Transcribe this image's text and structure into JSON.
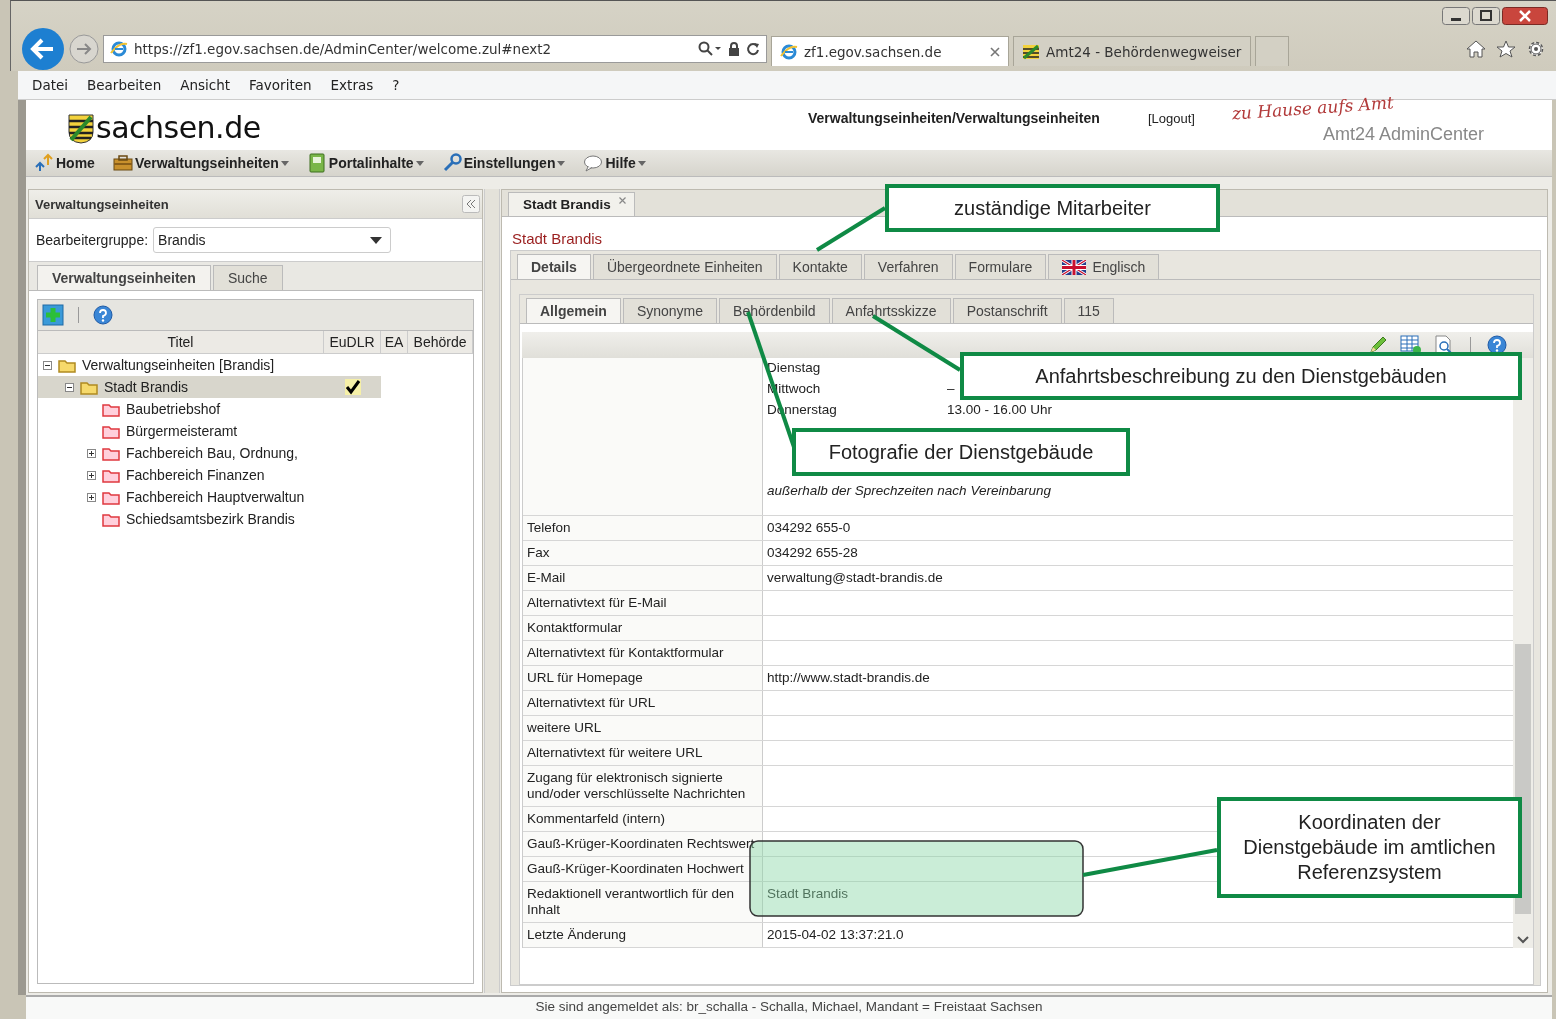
{
  "browser": {
    "url": "https://zf1.egov.sachsen.de/AdminCenter/welcome.zul#next2",
    "tabs": [
      {
        "title": "zf1.egov.sachsen.de",
        "selected": true
      },
      {
        "title": "Amt24 -  Behördenwegweiser",
        "selected": false
      }
    ]
  },
  "menu": [
    "Datei",
    "Bearbeiten",
    "Ansicht",
    "Favoriten",
    "Extras",
    "?"
  ],
  "header": {
    "logo": "sachsen.de",
    "breadcrumb": "Verwaltungseinheiten/Verwaltungseinheiten",
    "logout": "[Logout]",
    "slogan": "zu Hause aufs Amt",
    "product": "Amt24 AdminCenter"
  },
  "toolbar": [
    {
      "label": "Home",
      "kind": "home",
      "dropdown": false
    },
    {
      "label": "Verwaltungseinheiten",
      "kind": "units",
      "dropdown": true
    },
    {
      "label": "Portalinhalte",
      "kind": "content",
      "dropdown": true
    },
    {
      "label": "Einstellungen",
      "kind": "settings",
      "dropdown": true
    },
    {
      "label": "Hilfe",
      "kind": "help",
      "dropdown": true
    }
  ],
  "left_panel": {
    "title": "Verwaltungseinheiten",
    "group_label": "Bearbeitergruppe:",
    "group_value": "Brandis",
    "tabs": [
      {
        "label": "Verwaltungseinheiten",
        "selected": true
      },
      {
        "label": "Suche",
        "selected": false
      }
    ],
    "columns": [
      "Titel",
      "EuDLR",
      "EA",
      "Behörde"
    ],
    "tree": [
      {
        "label": "Verwaltungseinheiten [Brandis]",
        "expanded": true,
        "selected": false,
        "eudlr": false,
        "children": [
          {
            "label": "Stadt Brandis",
            "expanded": true,
            "selected": true,
            "eudlr": true,
            "children": [
              {
                "label": "Baubetriebshof",
                "selected": false,
                "eudlr": false
              },
              {
                "label": "Bürgermeisteramt",
                "selected": false,
                "eudlr": false
              },
              {
                "label": "Fachbereich Bau, Ordnung,",
                "expanded": false,
                "selected": false,
                "eudlr": false
              },
              {
                "label": "Fachbereich Finanzen",
                "expanded": false,
                "selected": false,
                "eudlr": false
              },
              {
                "label": "Fachbereich Hauptverwaltun",
                "expanded": false,
                "selected": false,
                "eudlr": false
              },
              {
                "label": "Schiedsamtsbezirk Brandis",
                "selected": false,
                "eudlr": false
              }
            ]
          }
        ]
      }
    ]
  },
  "detail": {
    "doc_tab": "Stadt Brandis",
    "heading": "Stadt Brandis",
    "tabs": [
      {
        "label": "Details",
        "selected": true,
        "kind": "text"
      },
      {
        "label": "Übergeordnete Einheiten",
        "selected": false,
        "kind": "text"
      },
      {
        "label": "Kontakte",
        "selected": false,
        "kind": "text"
      },
      {
        "label": "Verfahren",
        "selected": false,
        "kind": "text"
      },
      {
        "label": "Formulare",
        "selected": false,
        "kind": "text"
      },
      {
        "label": "Englisch",
        "selected": false,
        "kind": "flag"
      }
    ],
    "subtabs": [
      {
        "label": "Allgemein",
        "selected": true
      },
      {
        "label": "Synonyme",
        "selected": false
      },
      {
        "label": "Behördenbild",
        "selected": false
      },
      {
        "label": "Anfahrtsskizze",
        "selected": false
      },
      {
        "label": "Postanschrift",
        "selected": false
      },
      {
        "label": "115",
        "selected": false
      }
    ],
    "hours": [
      {
        "day": "Dienstag"
      },
      {
        "day": "Mittwoch",
        "time": "–"
      },
      {
        "day": "Donnerstag",
        "time": "13.00 - 16.00 Uhr"
      }
    ],
    "hours_note": "außerhalb der Sprechzeiten nach Vereinbarung",
    "rows": [
      {
        "label": "Telefon",
        "value": "034292 655-0"
      },
      {
        "label": "Fax",
        "value": "034292 655-28"
      },
      {
        "label": "E-Mail",
        "value": "verwaltung@stadt-brandis.de"
      },
      {
        "label": "Alternativtext für E-Mail"
      },
      {
        "label": "Kontaktformular"
      },
      {
        "label": "Alternativtext für Kontaktformular"
      },
      {
        "label": "URL für Homepage",
        "value": "http://www.stadt-brandis.de"
      },
      {
        "label": "Alternativtext für URL"
      },
      {
        "label": "weitere URL"
      },
      {
        "label": "Alternativtext für weitere URL"
      },
      {
        "label": "Zugang für elektronisch signierte und/oder verschlüsselte Nachrichten"
      },
      {
        "label": "Kommentarfeld (intern)"
      },
      {
        "label": "Gauß-Krüger-Koordinaten Rechtswert"
      },
      {
        "label": "Gauß-Krüger-Koordinaten Hochwert"
      },
      {
        "label": "Redaktionell verantwortlich für den Inhalt",
        "value": "Stadt Brandis"
      },
      {
        "label": "Letzte Änderung",
        "value": "2015-04-02 13:37:21.0"
      }
    ]
  },
  "callouts": [
    {
      "text": "zuständige Mitarbeiter"
    },
    {
      "text": "Anfahrtsbeschreibung zu den Dienstgebäuden"
    },
    {
      "text": "Fotografie der Dienstgebäude"
    },
    {
      "text": "Koordinaten der Dienstgebäude im amtlichen Referenzsystem"
    }
  ],
  "status_bar": "Sie sind angemeldet als: br_schalla - Schalla, Michael, Mandant = Freistaat Sachsen"
}
